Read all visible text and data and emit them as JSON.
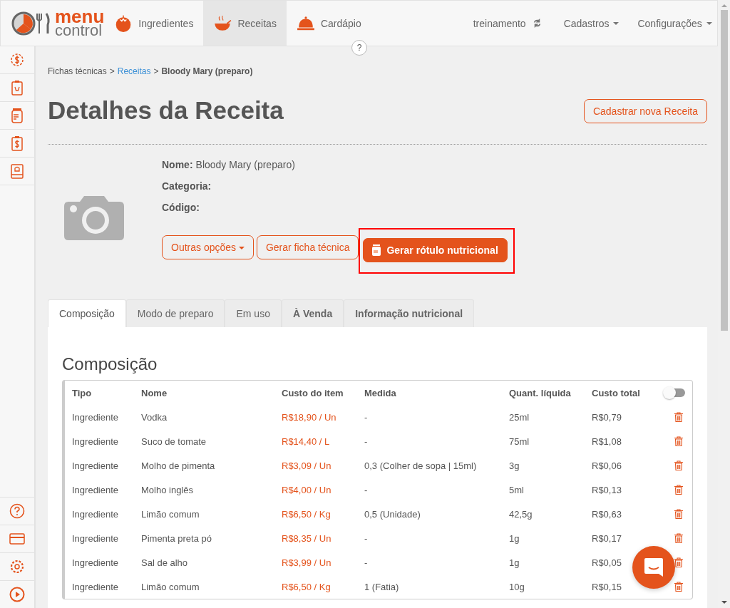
{
  "nav": {
    "logo": {
      "line1": "menu",
      "line2": "control"
    },
    "items": [
      {
        "label": "Ingredientes",
        "kind": "tomato",
        "selected": false
      },
      {
        "label": "Receitas",
        "kind": "pot",
        "selected": true
      },
      {
        "label": "Cardápio",
        "kind": "cloche",
        "selected": false
      }
    ],
    "help": "?",
    "account": "treinamento",
    "menus": [
      {
        "label": "Cadastros"
      },
      {
        "label": "Configurações"
      }
    ]
  },
  "sidebar": {
    "top": [
      {
        "kind": "gear-dollar"
      },
      {
        "kind": "clipboard-cart"
      },
      {
        "kind": "jar"
      },
      {
        "kind": "clipboard-dollar"
      },
      {
        "kind": "book"
      }
    ],
    "bottom": [
      {
        "kind": "help"
      },
      {
        "kind": "card"
      },
      {
        "kind": "gear"
      },
      {
        "kind": "play"
      }
    ]
  },
  "breadcrumb_separator": ">",
  "breadcrumb": [
    {
      "label": "Fichas técnicas",
      "kind": "plain"
    },
    {
      "label": "Receitas",
      "kind": "link"
    },
    {
      "label": "Bloody Mary (preparo)",
      "kind": "current"
    }
  ],
  "title": "Detalhes da **Receita**",
  "new_button": "Cadastrar nova Receita",
  "fields": [
    {
      "label": "Nome:",
      "value": "Bloody Mary (preparo)"
    },
    {
      "label": "Categoria:"
    },
    {
      "label": "Código:"
    }
  ],
  "buttons": [
    {
      "label": "Outras opções",
      "kind": "dropdown"
    },
    {
      "label": "Gerar ficha técnica",
      "kind": "outline"
    },
    {
      "label": "Gerar rótulo nutricional",
      "kind": "primary",
      "highlighted": true
    }
  ],
  "tabs": [
    {
      "label": "Composição",
      "selected": true
    },
    {
      "label": "Modo de preparo",
      "selected": false
    },
    {
      "label": "Em uso",
      "selected": false
    },
    {
      "label": "À Venda",
      "selected": false
    },
    {
      "label": "Informação nutricional",
      "selected": false
    }
  ],
  "section_title": "Composição",
  "table": {
    "columns": [
      "Tipo",
      "Nome",
      "Custo do item",
      "Medida",
      "Quant. líquida",
      "Custo total"
    ],
    "toggle": {
      "on": false
    },
    "rows": [
      [
        "Ingrediente",
        "Vodka",
        "R$18,90 / Un",
        "-",
        "25ml",
        "R$0,79"
      ],
      [
        "Ingrediente",
        "Suco de tomate",
        "R$14,40 / L",
        "-",
        "75ml",
        "R$1,08"
      ],
      [
        "Ingrediente",
        "Molho de pimenta",
        "R$3,09 / Un",
        "0,3 (Colher de sopa | 15ml)",
        "3g",
        "R$0,06"
      ],
      [
        "Ingrediente",
        "Molho inglês",
        "R$4,00 / Un",
        "-",
        "5ml",
        "R$0,13"
      ],
      [
        "Ingrediente",
        "Limão comum",
        "R$6,50 / Kg",
        "0,5 (Unidade)",
        "42,5g",
        "R$0,63"
      ],
      [
        "Ingrediente",
        "Pimenta preta pó",
        "R$8,35 / Un",
        "-",
        "1g",
        "R$0,17"
      ],
      [
        "Ingrediente",
        "Sal de alho",
        "R$3,99 / Un",
        "-",
        "1g",
        "R$0,05"
      ],
      [
        "Ingrediente",
        "Limão comum",
        "R$6,50 / Kg",
        "1 (Fatia)",
        "10g",
        "R$0,15"
      ]
    ]
  }
}
